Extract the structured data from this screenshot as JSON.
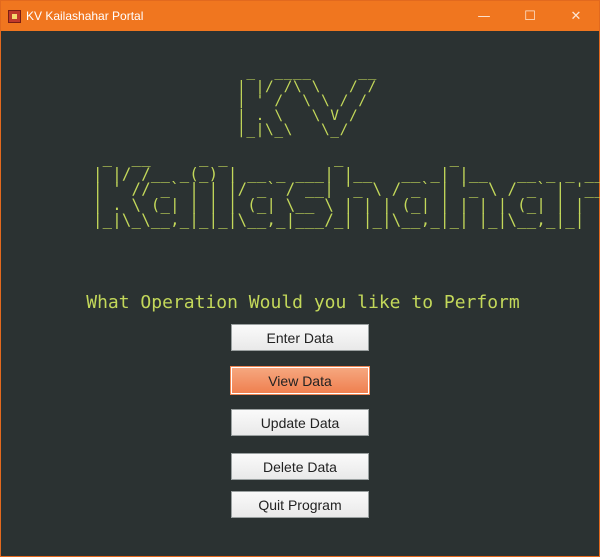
{
  "window": {
    "title": "KV Kailashahar Portal",
    "controls": {
      "minimize": "—",
      "maximize": "☐",
      "close": "✕"
    },
    "icon": "app-icon"
  },
  "banner": {
    "kv_ascii": " _  ____     __\n| |/ /\\ \\   / /\n| ' /  \\ \\ / / \n| . \\   \\ V /  \n|_|\\_\\   \\_/   ",
    "name_ascii": " _  __     _ _           _           _                \n| |/ /__ _(_) | __ _ ___| |__   __ _| |__   __ _ _ __ \n| ' // _` | | |/ _` / __| '_ \\ / _` | '_ \\ / _` | '__|\n| . \\ (_| | | | (_| \\__ \\ | | | (_| | | | | (_| | |   \n|_|\\_\\__,_|_|_|\\__,_|___/_| |_|\\__,_|_| |_|\\__,_|_|   "
  },
  "prompt": "What Operation Would you like to Perform",
  "buttons": {
    "enter": "Enter Data",
    "view": "View Data",
    "update": "Update Data",
    "delete": "Delete Data",
    "quit": "Quit Program"
  },
  "colors": {
    "titlebar": "#f0761f",
    "background": "#2b3232",
    "ascii_text": "#c3d85a",
    "button_hover": "#ef8050"
  }
}
